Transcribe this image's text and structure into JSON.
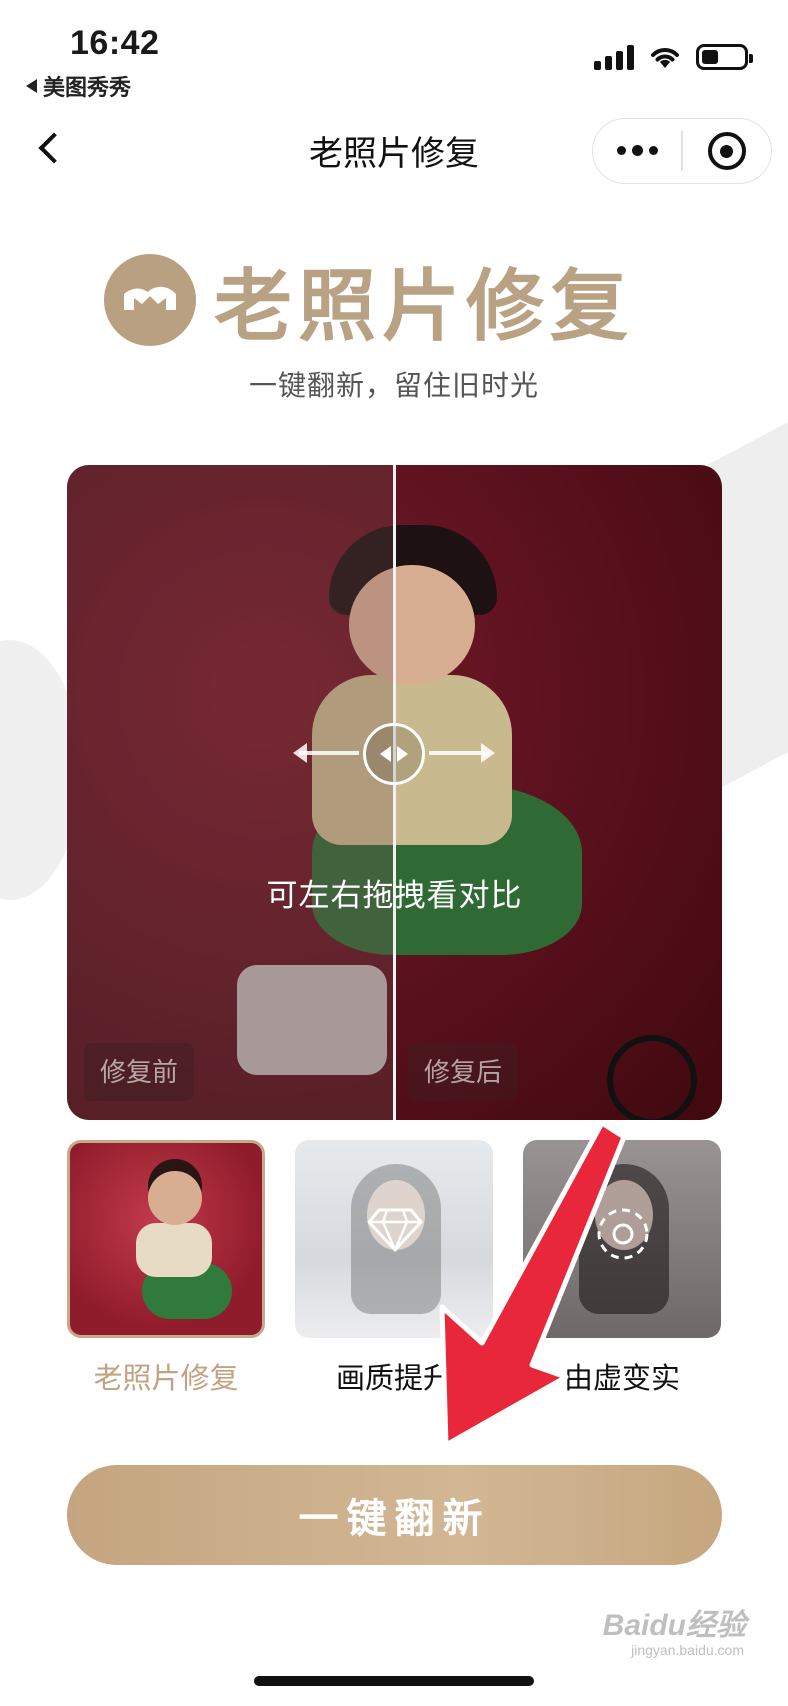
{
  "status_bar": {
    "time": "16:42",
    "back_app": "美图秀秀",
    "battery_level": 0.4
  },
  "nav": {
    "title": "老照片修复",
    "back_icon": "chevron-left-icon",
    "more_icon": "more-dots-icon",
    "close_icon": "target-circle-icon"
  },
  "hero": {
    "title": "老照片修复",
    "subtitle": "一键翻新，留住旧时光"
  },
  "compare": {
    "hint": "可左右拖拽看对比",
    "before_label": "修复前",
    "after_label": "修复后"
  },
  "modes": [
    {
      "label": "老照片修复",
      "active": true
    },
    {
      "label": "画质提升",
      "active": false,
      "icon": "diamond-icon"
    },
    {
      "label": "由虚变实",
      "active": false,
      "icon": "focus-circle-icon"
    }
  ],
  "cta_label": "一键翻新",
  "watermark": {
    "brand": "Baidu经验",
    "url": "jingyan.baidu.com"
  },
  "colors": {
    "accent_gold": "#c4a57f",
    "active_label": "#c2a283",
    "overlay_arrow": "#e8283a"
  }
}
